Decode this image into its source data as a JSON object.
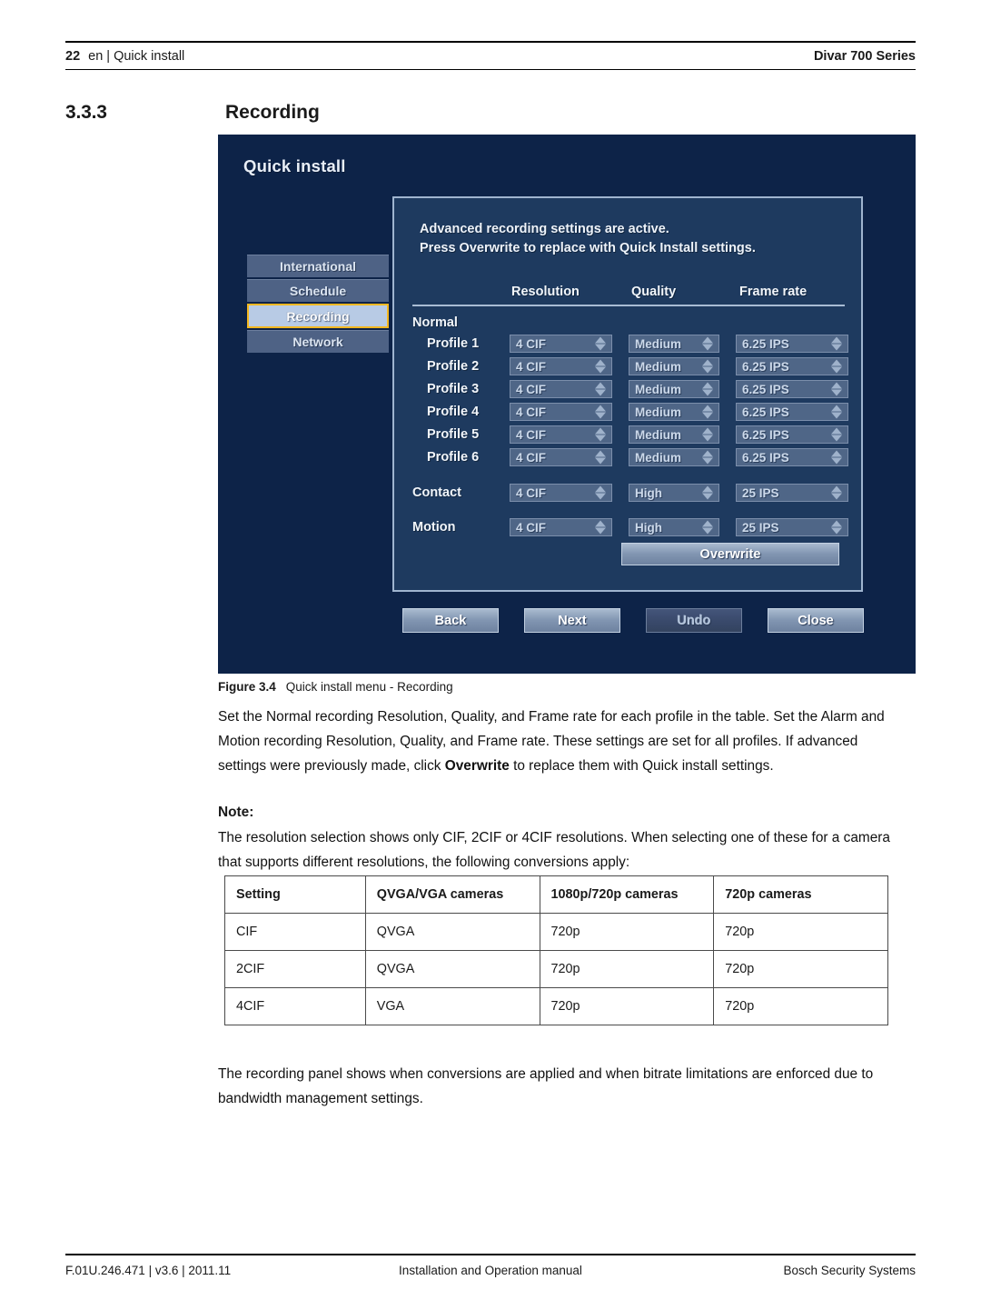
{
  "header": {
    "page_number": "22",
    "breadcrumb": "en | Quick install",
    "product": "Divar 700 Series"
  },
  "section": {
    "number": "3.3.3",
    "title": "Recording"
  },
  "screenshot": {
    "app_title": "Quick install",
    "colors": {
      "background": "#0d2348",
      "panel": "#1e3a5f",
      "nav_item": "#4e6285",
      "nav_active": "#b8cbe5",
      "nav_active_border": "#f5b820",
      "button": "#8296b2"
    },
    "nav": {
      "items": [
        {
          "label": "International",
          "active": false
        },
        {
          "label": "Schedule",
          "active": false
        },
        {
          "label": "Recording",
          "active": true
        },
        {
          "label": "Network",
          "active": false
        }
      ]
    },
    "dialog": {
      "message_line1": "Advanced recording settings are active.",
      "message_line2": "Press Overwrite to replace with Quick Install settings.",
      "columns": {
        "resolution": "Resolution",
        "quality": "Quality",
        "frame_rate": "Frame rate"
      },
      "group_label": "Normal",
      "rows": [
        {
          "label": "Profile 1",
          "resolution": "4 CIF",
          "quality": "Medium",
          "frame_rate": "6.25 IPS"
        },
        {
          "label": "Profile 2",
          "resolution": "4 CIF",
          "quality": "Medium",
          "frame_rate": "6.25 IPS"
        },
        {
          "label": "Profile 3",
          "resolution": "4 CIF",
          "quality": "Medium",
          "frame_rate": "6.25 IPS"
        },
        {
          "label": "Profile 4",
          "resolution": "4 CIF",
          "quality": "Medium",
          "frame_rate": "6.25 IPS"
        },
        {
          "label": "Profile 5",
          "resolution": "4 CIF",
          "quality": "Medium",
          "frame_rate": "6.25 IPS"
        },
        {
          "label": "Profile 6",
          "resolution": "4 CIF",
          "quality": "Medium",
          "frame_rate": "6.25 IPS"
        }
      ],
      "extra_rows": [
        {
          "label": "Contact",
          "resolution": "4 CIF",
          "quality": "High",
          "frame_rate": "25 IPS"
        },
        {
          "label": "Motion",
          "resolution": "4 CIF",
          "quality": "High",
          "frame_rate": "25 IPS"
        }
      ],
      "overwrite_label": "Overwrite"
    },
    "buttons": {
      "back": "Back",
      "next": "Next",
      "undo": "Undo",
      "close": "Close"
    }
  },
  "figure": {
    "label": "Figure 3.4",
    "caption": "Quick install menu - Recording"
  },
  "body": {
    "paragraph1_a": "Set the Normal recording Resolution, Quality, and Frame rate for each profile in the table. Set the Alarm and Motion recording Resolution, Quality, and Frame rate. These settings are set for all profiles. If advanced settings were previously made, click ",
    "paragraph1_bold": "Overwrite",
    "paragraph1_b": " to replace them with Quick install settings.",
    "note_heading": "Note:",
    "paragraph2": "The resolution selection shows only CIF, 2CIF or 4CIF resolutions. When selecting one of these for a camera that supports different resolutions, the following conversions apply:",
    "paragraph3": "The recording panel shows when conversions are applied and when bitrate limitations are enforced due to bandwidth management settings."
  },
  "conversion_table": {
    "headers": [
      "Setting",
      "QVGA/VGA cameras",
      "1080p/720p cameras",
      "720p cameras"
    ],
    "rows": [
      [
        "CIF",
        "QVGA",
        "720p",
        "720p"
      ],
      [
        "2CIF",
        "QVGA",
        "720p",
        "720p"
      ],
      [
        "4CIF",
        "VGA",
        "720p",
        "720p"
      ]
    ]
  },
  "footer": {
    "left": "F.01U.246.471 | v3.6 | 2011.11",
    "middle": "Installation and Operation manual",
    "right": "Bosch Security Systems"
  }
}
